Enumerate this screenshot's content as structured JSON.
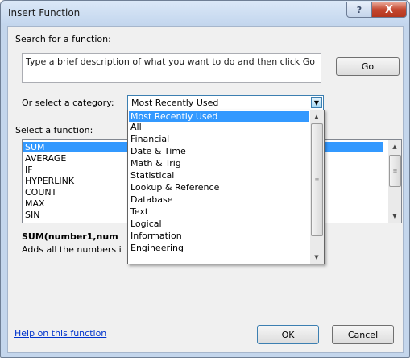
{
  "window": {
    "title": "Insert Function",
    "help_glyph": "?",
    "close_glyph": "X"
  },
  "search": {
    "label": "Search for a function:",
    "placeholder": "Type a brief description of what you want to do and then click Go",
    "go_label": "Go"
  },
  "category": {
    "label": "Or select a category:",
    "selected": "Most Recently Used",
    "options": [
      "Most Recently Used",
      "All",
      "Financial",
      "Date & Time",
      "Math & Trig",
      "Statistical",
      "Lookup & Reference",
      "Database",
      "Text",
      "Logical",
      "Information",
      "Engineering"
    ]
  },
  "functions": {
    "label": "Select a function:",
    "items": [
      "SUM",
      "AVERAGE",
      "IF",
      "HYPERLINK",
      "COUNT",
      "MAX",
      "SIN"
    ],
    "selected": "SUM"
  },
  "description": {
    "signature": "SUM(number1,num",
    "text": "Adds all the numbers i"
  },
  "footer": {
    "help_link": "Help on this function",
    "ok_label": "OK",
    "cancel_label": "Cancel"
  },
  "icons": {
    "dropdown_arrow": "chevron-down-icon",
    "scroll_up": "scroll-up-icon",
    "scroll_down": "scroll-down-icon",
    "grip": "scroll-grip-icon"
  }
}
